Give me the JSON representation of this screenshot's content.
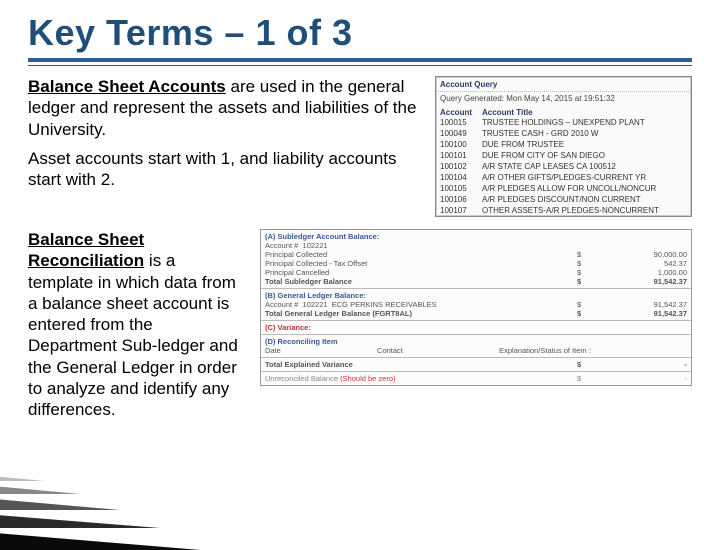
{
  "title": "Key Terms – 1 of 3",
  "para1": {
    "term": "Balance Sheet Accounts",
    "rest": " are used in the general ledger and represent the assets and liabilities of the University."
  },
  "para1b": "Asset accounts start with 1, and liability accounts start with 2.",
  "query": {
    "heading": "Account Query",
    "generated": "Query Generated: Mon May 14, 2015 at 19:51:32",
    "col1": "Account",
    "col2": "Account Title",
    "rows": [
      {
        "acct": "100015",
        "title": "TRUSTEE HOLDINGS – UNEXPEND PLANT"
      },
      {
        "acct": "100049",
        "title": "TRUSTEE CASH - GRD 2010 W"
      },
      {
        "acct": "100100",
        "title": "DUE FROM TRUSTEE"
      },
      {
        "acct": "100101",
        "title": "DUE FROM CITY OF SAN DIEGO"
      },
      {
        "acct": "100102",
        "title": "A/R STATE CAP LEASES CA 100512"
      },
      {
        "acct": "100104",
        "title": "A/R OTHER GIFTS/PLEDGES-CURRENT YR"
      },
      {
        "acct": "100105",
        "title": "A/R PLEDGES ALLOW FOR UNCOLL/NONCUR"
      },
      {
        "acct": "100106",
        "title": "A/R PLEDGES DISCOUNT/NON CURRENT"
      },
      {
        "acct": "100107",
        "title": "OTHER ASSETS-A/R PLEDGES-NONCURRENT"
      }
    ]
  },
  "para2": {
    "term": "Balance Sheet Reconciliation",
    "rest_a": " is a template in which data from a balance sheet account is entered from the Department Sub-ledger and the General Ledger in order to analyze and identify any differences."
  },
  "recon": {
    "sec_a_title": "(A) Subledger Account Balance:",
    "acct_label": "Account #",
    "acct_no": "102221",
    "lines_a": [
      {
        "label": "Principal Collected",
        "cur": "$",
        "val": "90,000.00"
      },
      {
        "label": "Principal Collected - Tax Offset",
        "cur": "$",
        "val": "542.37"
      },
      {
        "label": "Principal Cancelled",
        "cur": "$",
        "val": "1,000.00"
      }
    ],
    "subledger_total_label": "Total Subledger Balance",
    "subledger_total": "91,542.37",
    "sec_b_title": "(B) General Ledger Balance:",
    "gl_label": "ECG PERKINS RECEIVABLES",
    "gl_val": "91,542.37",
    "gl_total_label": "Total General Ledger Balance (FGRT8AL)",
    "gl_total": "91,542.37",
    "sec_c_title": "(C) Variance:",
    "sec_d_title": "(D) Reconciling Item",
    "date_label": "Date",
    "contact_label": "Contact",
    "exp_label": "Explanation/Status of Item :",
    "var_total_label": "Total Explained Variance",
    "var_total": "-",
    "unrec_label": "Unreconciled Balance",
    "unrec_note": "(Should be zero)",
    "unrec_val": "-"
  }
}
